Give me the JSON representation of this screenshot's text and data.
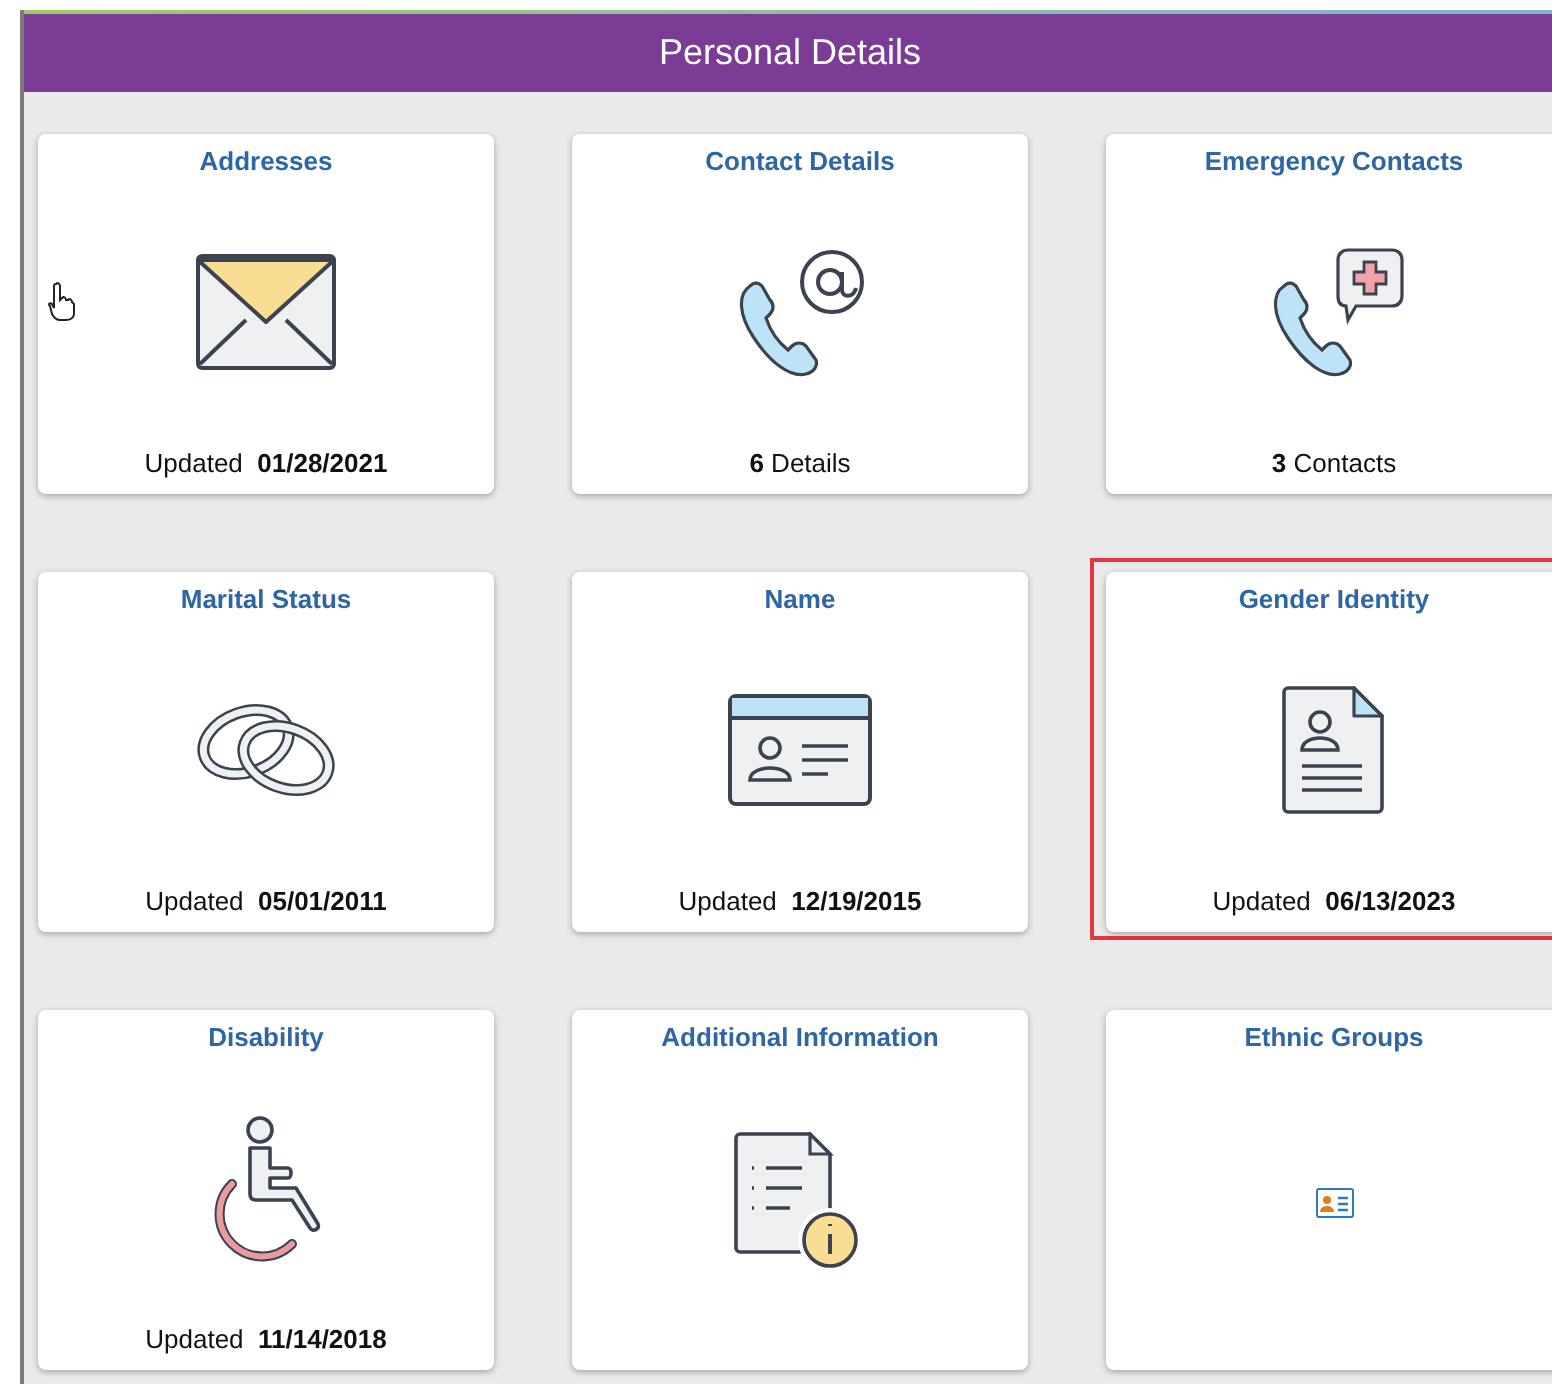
{
  "header": {
    "title": "Personal Details"
  },
  "tiles": [
    {
      "title": "Addresses",
      "footer": "Updated  **01/28/2021**",
      "highlighted": false
    },
    {
      "title": "Contact Details",
      "footer": "**6** Details",
      "highlighted": false
    },
    {
      "title": "Emergency Contacts",
      "footer": "**3** Contacts",
      "highlighted": false
    },
    {
      "title": "Marital Status",
      "footer": "Updated  **05/01/2011**",
      "highlighted": false
    },
    {
      "title": "Name",
      "footer": "Updated  **12/19/2015**",
      "highlighted": false
    },
    {
      "title": "Gender Identity",
      "footer": "Updated  **06/13/2023**",
      "highlighted": true
    },
    {
      "title": "Disability",
      "footer": "Updated  **11/14/2018**",
      "highlighted": false
    },
    {
      "title": "Additional Information",
      "highlighted": false
    },
    {
      "title": "Ethnic Groups",
      "highlighted": false
    }
  ]
}
